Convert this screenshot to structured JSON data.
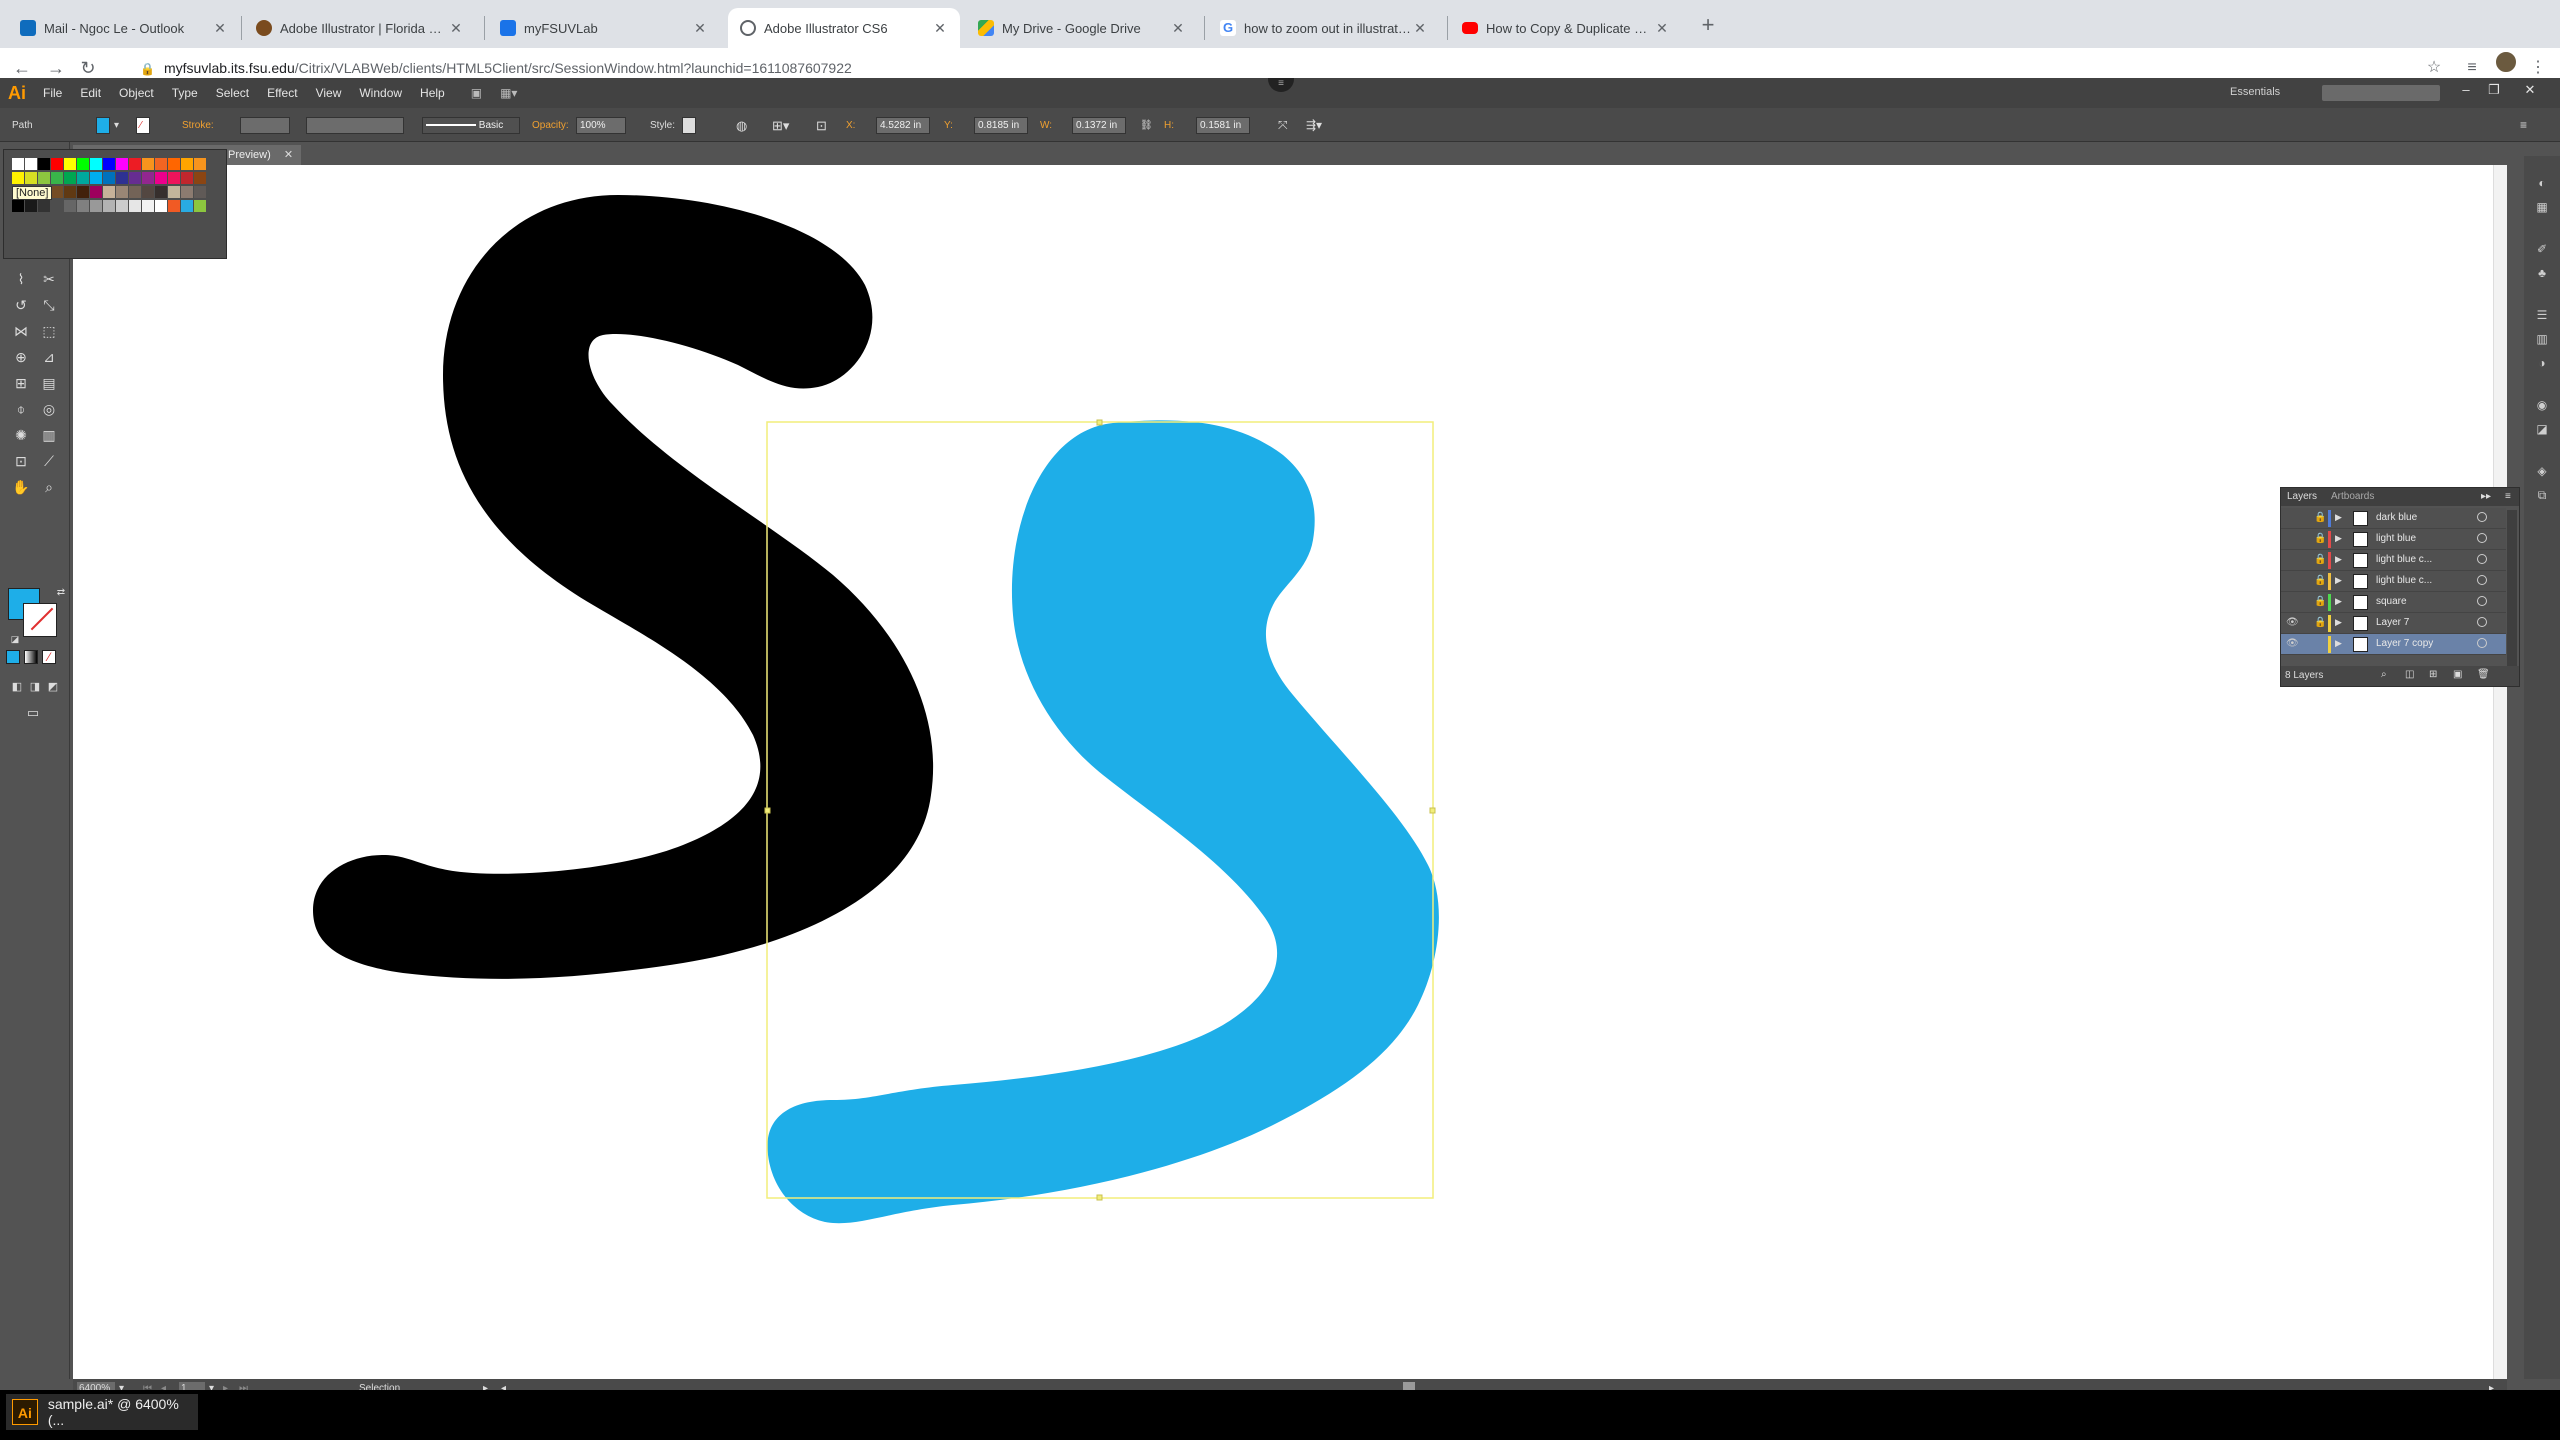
{
  "browser": {
    "tabs": [
      {
        "title": "Mail - Ngoc Le - Outlook",
        "color": "#0f6cbd"
      },
      {
        "title": "Adobe Illustrator | Florida State",
        "color": "#7a4b1e"
      },
      {
        "title": "myFSUVLab",
        "color": "#1a73e8"
      },
      {
        "title": "Adobe Illustrator CS6",
        "color": "#5f6368"
      },
      {
        "title": "My Drive - Google Drive",
        "color": "#34a853"
      },
      {
        "title": "how to zoom out in illustrator -",
        "color": "#4285f4"
      },
      {
        "title": "How to Copy & Duplicate Layers",
        "color": "#ff0000"
      }
    ],
    "new_tab": "+",
    "url_host": "myfsuvlab.its.fsu.edu",
    "url_path": "/Citrix/VLABWeb/clients/HTML5Client/src/SessionWindow.html?launchid=1611087607922"
  },
  "illustrator": {
    "logo": "Ai",
    "menus": [
      "File",
      "Edit",
      "Object",
      "Type",
      "Select",
      "Effect",
      "View",
      "Window",
      "Help"
    ],
    "workspace": "Essentials",
    "control": {
      "selection_type": "Path",
      "stroke_label": "Stroke:",
      "brush_label": "Basic",
      "opacity_label": "Opacity:",
      "opacity_value": "100%",
      "style_label": "Style:",
      "x_label": "X:",
      "x_value": "4.5282 in",
      "y_label": "Y:",
      "y_value": "0.8185 in",
      "w_label": "W:",
      "w_value": "0.1372 in",
      "h_label": "H:",
      "h_value": "0.1581 in"
    },
    "doc_tab": "Preview)",
    "swatch_tooltip": "[None]",
    "fill_color": "#1eaee8",
    "layers_panel": {
      "tab_layers": "Layers",
      "tab_artboards": "Artboards",
      "rows": [
        {
          "name": "dark blue",
          "color": "#4f7bd8",
          "visible": false,
          "locked": true,
          "selected": false
        },
        {
          "name": "light blue",
          "color": "#e34a4a",
          "visible": false,
          "locked": true,
          "selected": false
        },
        {
          "name": "light blue c...",
          "color": "#e34a4a",
          "visible": false,
          "locked": true,
          "selected": false
        },
        {
          "name": "light blue c...",
          "color": "#f0c040",
          "visible": false,
          "locked": true,
          "selected": false
        },
        {
          "name": "square",
          "color": "#4fd84f",
          "visible": false,
          "locked": true,
          "selected": false
        },
        {
          "name": "Layer 7",
          "color": "#f0d040",
          "visible": true,
          "locked": true,
          "selected": false
        },
        {
          "name": "Layer 7 copy",
          "color": "#f0d040",
          "visible": true,
          "locked": false,
          "selected": true
        }
      ],
      "count_label": "8 Layers"
    },
    "status": {
      "zoom": "6400%",
      "artboard": "1",
      "tool_name": "Selection"
    },
    "shapes": {
      "black_s_color": "#000000",
      "blue_s_color": "#1eaee8",
      "selection_color": "#f2ee7a"
    }
  },
  "taskbar": {
    "item_icon": "Ai",
    "item_label": "sample.ai* @ 6400% (..."
  }
}
